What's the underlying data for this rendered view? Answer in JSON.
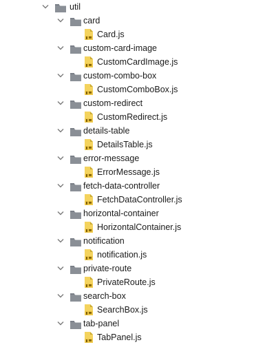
{
  "root": {
    "name": "util",
    "expanded": true,
    "icon": "folder-icon"
  },
  "folders": [
    {
      "name": "card",
      "file": "Card.js"
    },
    {
      "name": "custom-card-image",
      "file": "CustomCardImage.js"
    },
    {
      "name": "custom-combo-box",
      "file": "CustomComboBox.js"
    },
    {
      "name": "custom-redirect",
      "file": "CustomRedirect.js"
    },
    {
      "name": "details-table",
      "file": "DetailsTable.js"
    },
    {
      "name": "error-message",
      "file": "ErrorMessage.js"
    },
    {
      "name": "fetch-data-controller",
      "file": "FetchDataController.js"
    },
    {
      "name": "horizontal-container",
      "file": "HorizontalContainer.js"
    },
    {
      "name": "notification",
      "file": "notification.js"
    },
    {
      "name": "private-route",
      "file": "PrivateRoute.js"
    },
    {
      "name": "search-box",
      "file": "SearchBox.js"
    },
    {
      "name": "tab-panel",
      "file": "TabPanel.js"
    }
  ],
  "colors": {
    "folder": "#8a8f96",
    "folder_tab": "#7b8088",
    "chevron": "#7a7a7a",
    "js_page": "#f4d35e",
    "js_fold": "#c9a92f",
    "js_text": "#7a5a00",
    "text": "#1a1a1a"
  }
}
